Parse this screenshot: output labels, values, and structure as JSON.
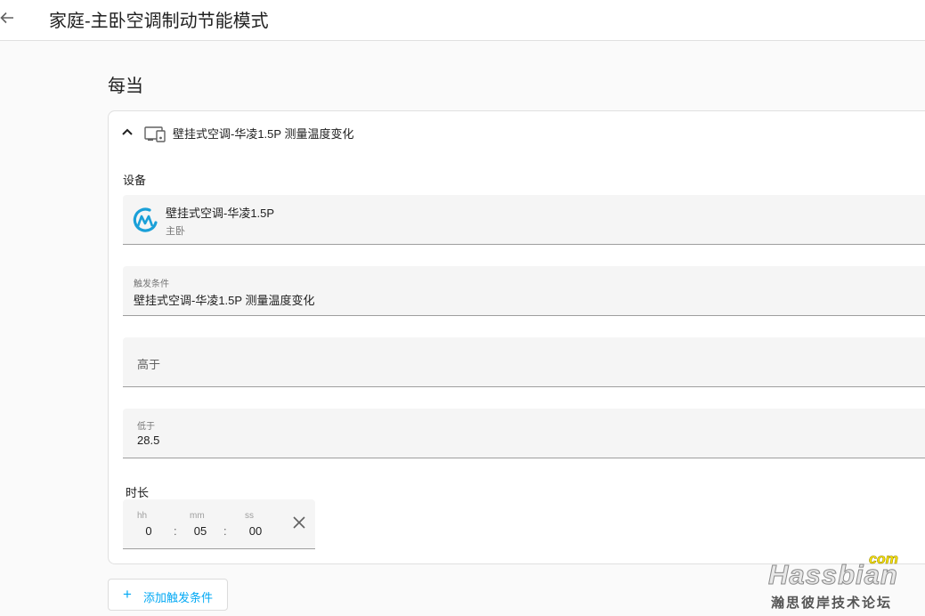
{
  "header": {
    "back_icon": "arrow-left-icon",
    "title": "家庭-主卧空调制动节能模式"
  },
  "section": {
    "title": "每当"
  },
  "trigger": {
    "summary": "壁挂式空调-华凌1.5P 测量温度变化",
    "device_label": "设备",
    "device": {
      "name": "壁挂式空调-华凌1.5P",
      "area": "主卧",
      "logo": "midea-logo"
    },
    "condition": {
      "label": "触发条件",
      "value": "壁挂式空调-华凌1.5P 测量温度变化"
    },
    "above": {
      "label": "高于",
      "value": ""
    },
    "below": {
      "label": "低于",
      "value": "28.5"
    },
    "duration": {
      "label": "时长",
      "hh_label": "hh",
      "mm_label": "mm",
      "ss_label": "ss",
      "hh": "0",
      "mm": "05",
      "ss": "00",
      "separator": ":"
    }
  },
  "add_button": {
    "label": "添加触发条件"
  },
  "watermark": {
    "main": "Hassbian",
    "com": "com",
    "sub": "瀚思彼岸技术论坛"
  },
  "colors": {
    "accent": "#03a9f4",
    "field_bg": "#f5f5f5"
  }
}
